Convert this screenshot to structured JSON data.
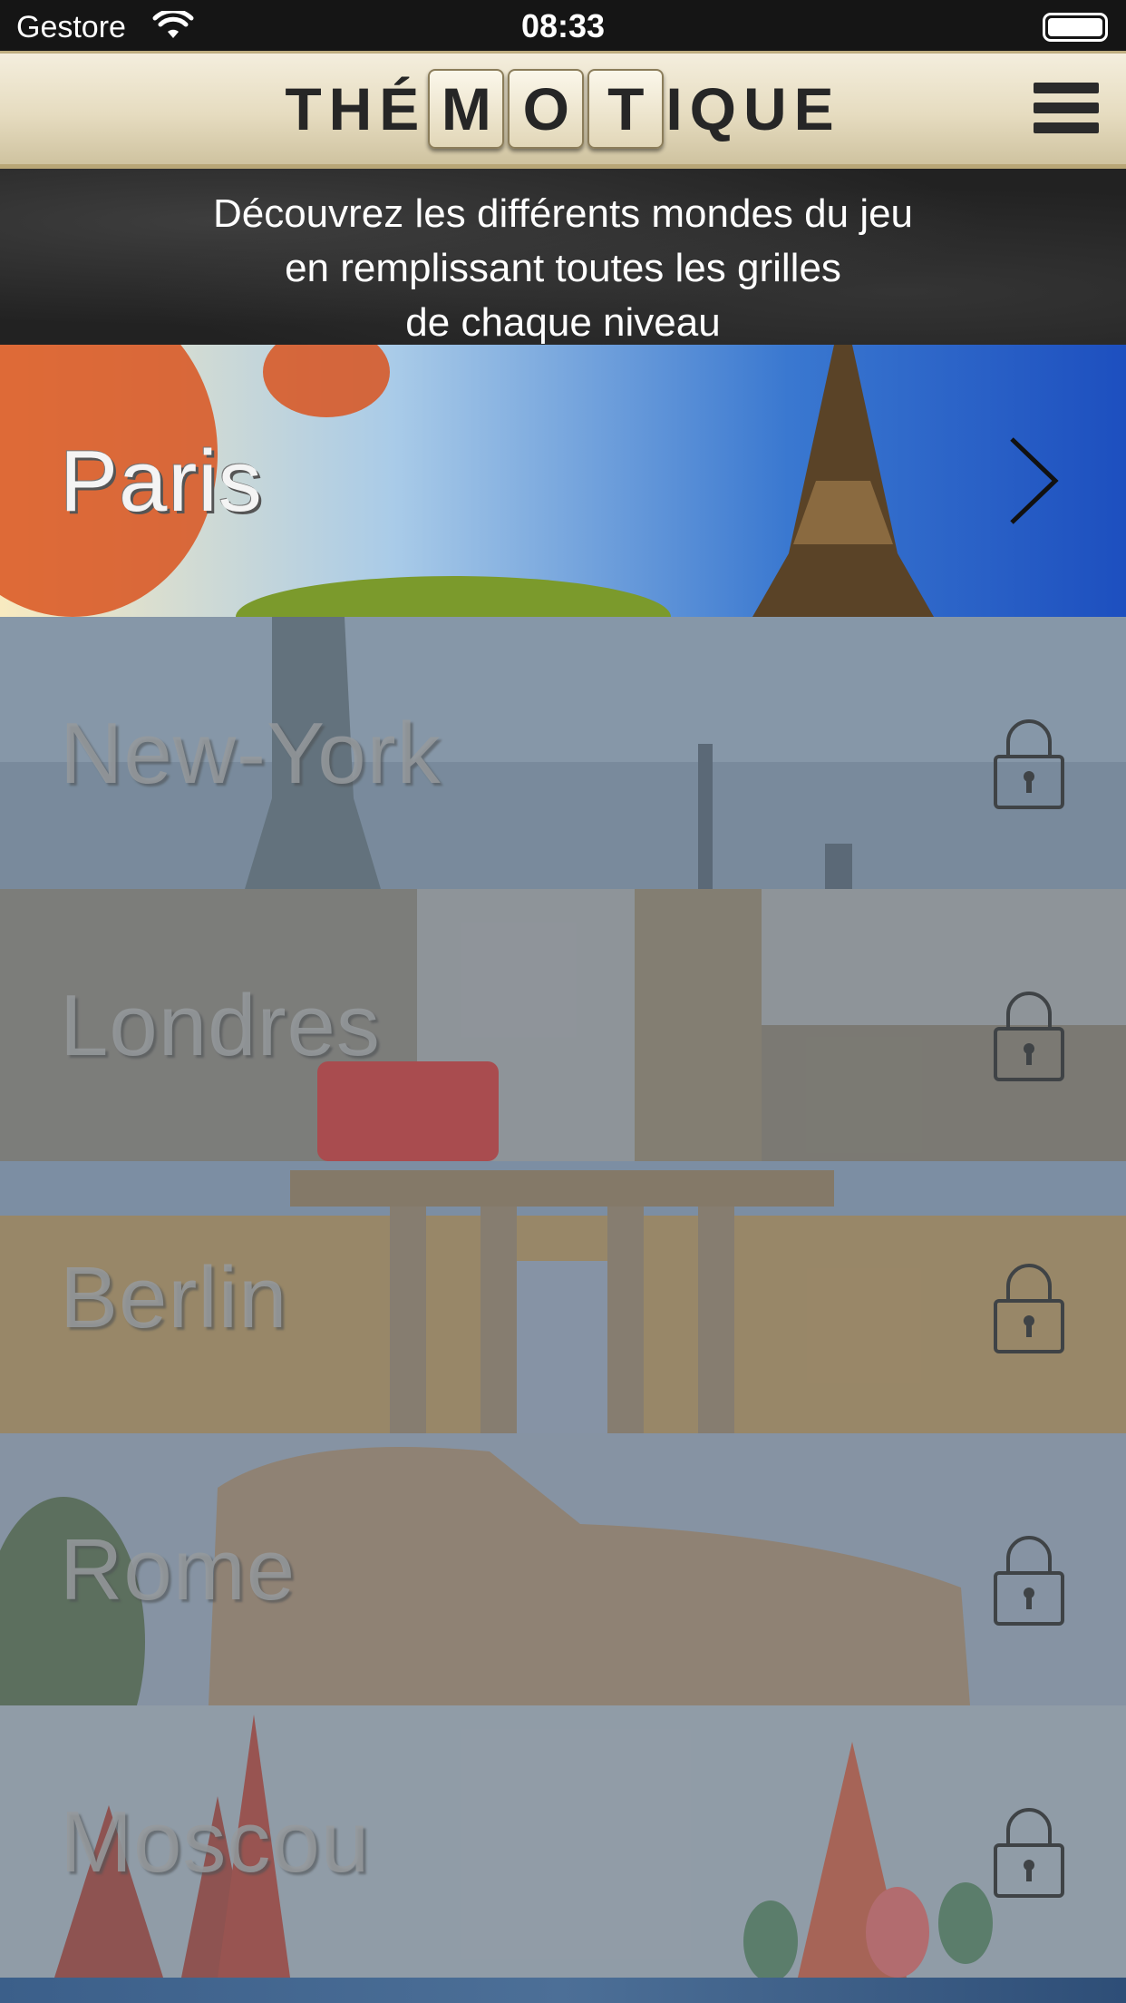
{
  "status_bar": {
    "carrier": "Gestore",
    "time": "08:33"
  },
  "header": {
    "logo": {
      "prefix": "THÉ",
      "tiles": [
        "M",
        "O",
        "T"
      ],
      "suffix": "IQUE"
    }
  },
  "intro": {
    "lines": [
      "Découvrez les différents mondes du jeu",
      "en remplissant toutes les grilles",
      "de chaque niveau"
    ]
  },
  "levels": [
    {
      "name": "Paris",
      "locked": false
    },
    {
      "name": "New-York",
      "locked": true
    },
    {
      "name": "Londres",
      "locked": true
    },
    {
      "name": "Berlin",
      "locked": true
    },
    {
      "name": "Rome",
      "locked": true
    },
    {
      "name": "Moscou",
      "locked": true
    }
  ],
  "icons": {
    "menu": "hamburger-menu-icon",
    "lock": "padlock-icon",
    "chevron": "chevron-right-icon",
    "wifi": "wifi-icon",
    "battery": "battery-icon"
  },
  "colors": {
    "header_bg": "#e6dcc0",
    "logo_text": "#262626",
    "intro_bg": "#222222",
    "intro_text": "#ffffff"
  }
}
